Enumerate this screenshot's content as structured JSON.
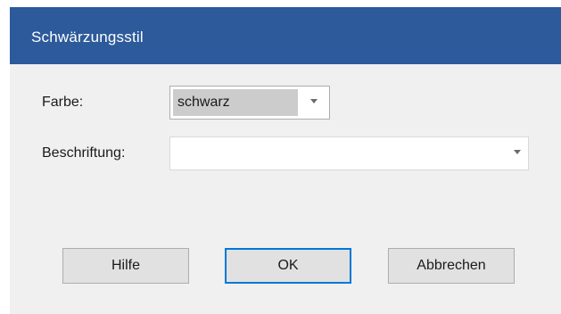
{
  "dialog": {
    "title": "Schwärzungsstil"
  },
  "form": {
    "farbe_label": "Farbe:",
    "farbe_value": "schwarz",
    "beschriftung_label": "Beschriftung:",
    "beschriftung_value": ""
  },
  "buttons": {
    "help": "Hilfe",
    "ok": "OK",
    "cancel": "Abbrechen"
  },
  "icons": {
    "dropdown": "chevron-down-icon"
  },
  "colors": {
    "titlebar": "#2c5a9b",
    "focus_border": "#0078d7"
  }
}
